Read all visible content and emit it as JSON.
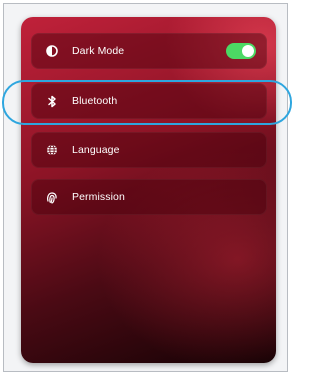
{
  "settings": {
    "items": [
      {
        "label": "Dark Mode",
        "icon": "half-moon-contrast-icon",
        "toggle_on": true
      },
      {
        "label": "Bluetooth",
        "icon": "bluetooth-icon",
        "highlighted": true
      },
      {
        "label": "Language",
        "icon": "globe-icon"
      },
      {
        "label": "Permission",
        "icon": "fingerprint-icon"
      }
    ]
  },
  "colors": {
    "accent_toggle": "#4cd964",
    "highlight_ring": "#2ea6df",
    "panel_red": "#c0213a"
  }
}
